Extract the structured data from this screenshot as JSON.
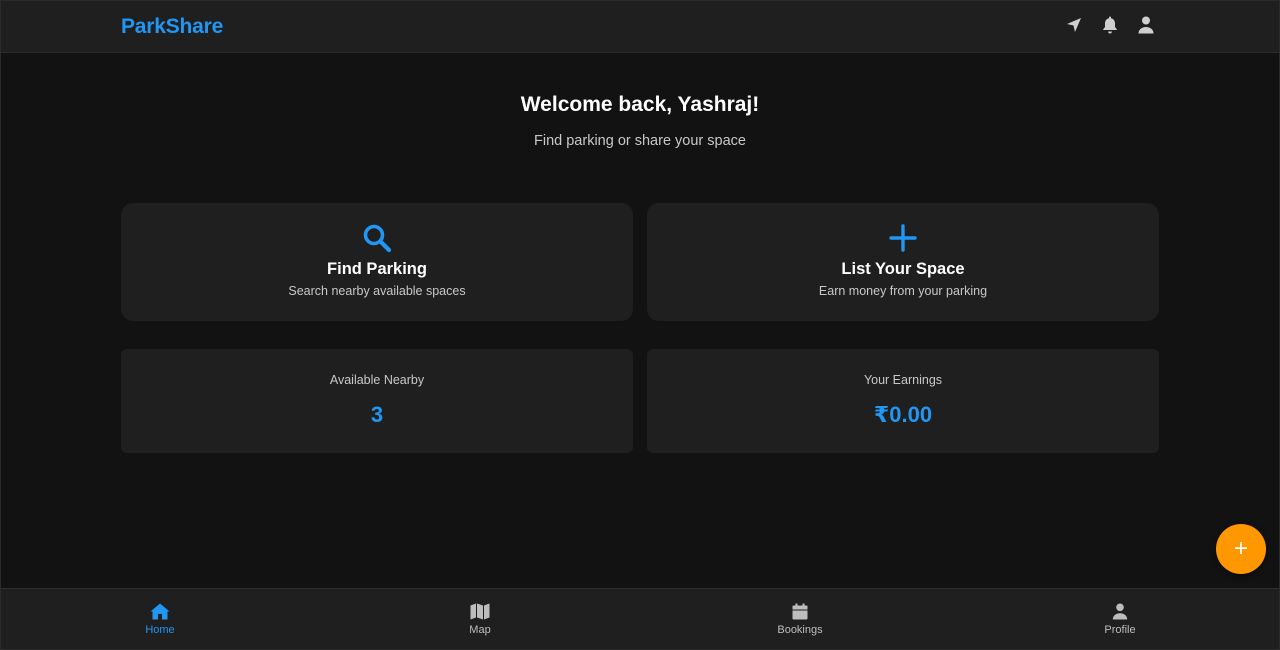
{
  "app": {
    "brand": "ParkShare",
    "accent_color": "#2196f3",
    "fab_color": "#ff9800"
  },
  "header": {
    "icons": [
      "location-arrow-icon",
      "bell-icon",
      "user-icon"
    ]
  },
  "welcome": {
    "title": "Welcome back, Yashraj!",
    "subtitle": "Find parking or share your space"
  },
  "actions": [
    {
      "icon": "search-icon",
      "title": "Find Parking",
      "subtitle": "Search nearby available spaces"
    },
    {
      "icon": "plus-icon",
      "title": "List Your Space",
      "subtitle": "Earn money from your parking"
    }
  ],
  "stats": [
    {
      "label": "Available Nearby",
      "value": "3"
    },
    {
      "label": "Your Earnings",
      "value": "₹0.00"
    }
  ],
  "fab": {
    "icon": "plus-icon",
    "glyph": "+"
  },
  "bottom_nav": {
    "active": "Home",
    "items": [
      {
        "icon": "home-icon",
        "label": "Home"
      },
      {
        "icon": "map-icon",
        "label": "Map"
      },
      {
        "icon": "calendar-icon",
        "label": "Bookings"
      },
      {
        "icon": "user-icon",
        "label": "Profile"
      }
    ]
  }
}
